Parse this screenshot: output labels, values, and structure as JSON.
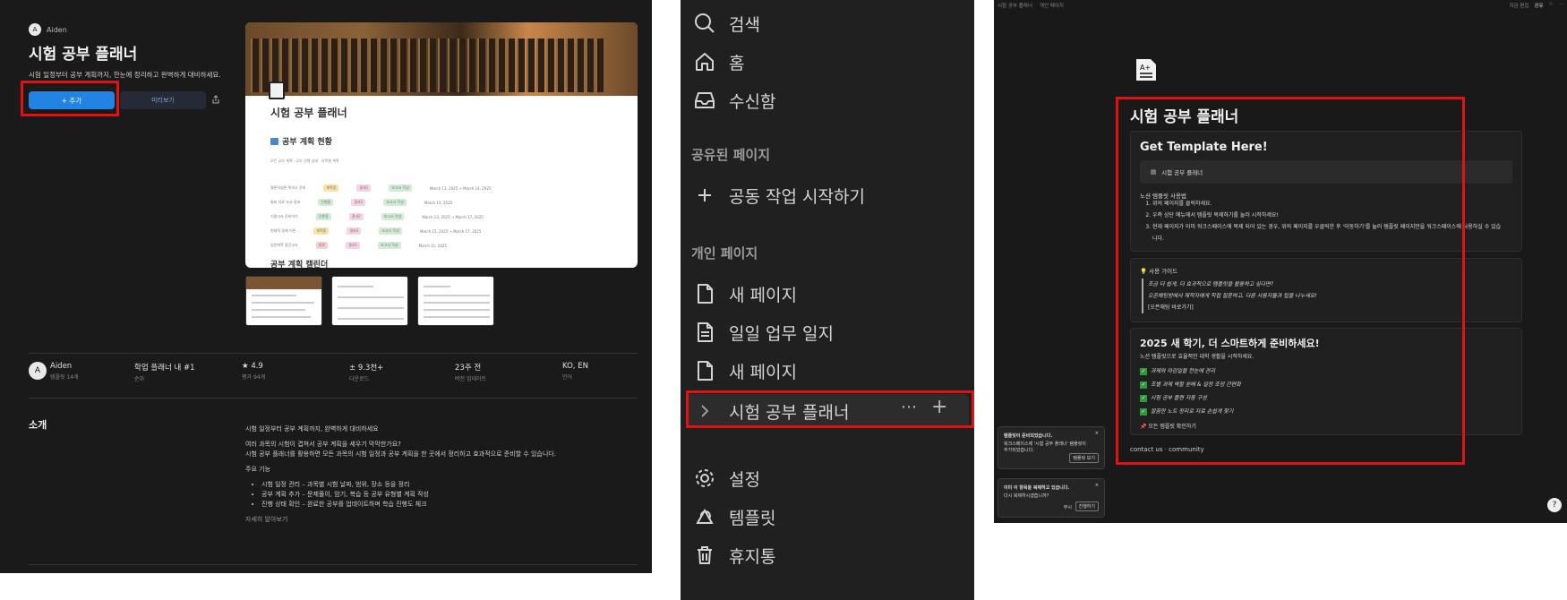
{
  "marketplace": {
    "author": "Aiden",
    "avatar_glyph": "A",
    "title": "시험 공부 플래너",
    "subtitle": "시험 일정부터 공부 계획까지, 한눈에 정리하고 완벽하게 대비하세요.",
    "add_button": "+ 추가",
    "preview_button": "미리보기",
    "preview": {
      "title": "시험 공부 플래너",
      "section": "공부 계획 현황",
      "tabs": "모든 공부 계획 · 공부 진행 상태 · 과목별 계획",
      "rows": [
        {
          "name": "결론작성론 족의고 준비",
          "status": "계획중",
          "tag2": "결과1",
          "tag3": "보고서 작성",
          "date": "March 13, 2025 → March 14, 2025"
        },
        {
          "name": "발표 자료 조사 정리",
          "status": "진행중",
          "tag2": "결과2",
          "tag3": "보고서 작성",
          "date": "March 13, 2025"
        },
        {
          "name": "기말고사 준비하기",
          "status": "진행중",
          "tag2": "결과2",
          "tag3": "보고서 작성",
          "date": "March 13, 2025 → March 17, 2025"
        },
        {
          "name": "현대적 경제 이론",
          "status": "계획중",
          "tag2": "결과3",
          "tag3": "보고서 작성",
          "date": "March 15, 2025 → March 17, 2025"
        },
        {
          "name": "일반화학 중간고사",
          "status": "완료",
          "tag2": "결과1",
          "tag3": "보고서 작성",
          "date": "March 11, 2025"
        }
      ],
      "calendar_heading": "공부 계획 캘린더"
    },
    "stats": [
      {
        "value": "Aiden",
        "label": "템플릿 14개"
      },
      {
        "value": "학업 플래너 내 #1",
        "label": "순위"
      },
      {
        "value": "★ 4.9",
        "label": "평가 94개"
      },
      {
        "value": "± 9.3천+",
        "label": "다운로드"
      },
      {
        "value": "23주 전",
        "label": "버전 업데이트"
      },
      {
        "value": "KO, EN",
        "label": "언어"
      }
    ],
    "intro_label": "소개",
    "intro_p1": "시험 일정부터 공부 계획까지, 완벽하게 대비하세요",
    "intro_p2": "여러 과목의 시험이 겹쳐서 공부 계획을 세우기 막막한가요?",
    "intro_p3": "시험 공부 플래너를 활용하면 모든 과목의 시험 일정과 공부 계획을 한 곳에서 정리하고 효과적으로 준비할 수 있습니다.",
    "features_label": "주요 기능",
    "features": [
      "시험 일정 관리 – 과목별 시험 날짜, 범위, 장소 등을 정리",
      "공부 계획 추가 – 문제풀이, 암기, 복습 등 공부 유형별 계획 작성",
      "진행 상태 확인 – 완료한 공부를 업데이트하며 학습 진행도 체크"
    ],
    "more": "자세히 알아보기"
  },
  "sidebar": {
    "search": "검색",
    "home": "홈",
    "inbox": "수신함",
    "shared_heading": "공유된 페이지",
    "start_collab": "공동 작업 시작하기",
    "private_heading": "개인 페이지",
    "pages": [
      "새 페이지",
      "일일 업무 일지",
      "새 페이지"
    ],
    "active_page": "시험 공부 플래너",
    "settings": "설정",
    "templates": "템플릿",
    "trash": "휴지통"
  },
  "notion_page": {
    "breadcrumb_1": "시험 공부 플래너",
    "breadcrumb_2": "개인 페이지",
    "edited": "지금 편집",
    "share": "공유",
    "title": "시험 공부 플래너",
    "get_template": "Get Template Here!",
    "template_link": "시험 공부 플래너",
    "usage_heading": "노션 템플릿 사용법",
    "steps": [
      "위의 페이지를 클릭하세요.",
      "우측 상단 메뉴에서 템플릿 복제하기를 눌러 시작하세요!",
      "현재 페이지가 이미 워크스페이스에 복제 되어 있는 경우, 위의 페이지를 우클릭한 후 '이동하기'를 눌러 템플릿 페이지만을 워크스페이스에 사용하실 수 있습니다."
    ],
    "guide_heading": "사용 가이드",
    "guide_q1": "조금 더 쉽게, 더 효과적으로 템플릿을 활용하고 싶다면?",
    "guide_q2": "오픈채팅방에서 제작자에게 직접 질문하고, 다른 사용자들과 팁을 나누세요!",
    "guide_link": "[오픈채팅 바로가기]",
    "promo_heading": "2025 새 학기, 더 스마트하게 준비하세요!",
    "promo_desc": "노션 템플릿으로 효율적인 대학 생활을 시작하세요.",
    "promo_items": [
      "과제와 마감일을 한눈에 관리",
      "조별 과제 역할 분배 & 일정 조정 간편화",
      "시험 공부 플랜 자동 구성",
      "깔끔한 노트 정리로 자료 손쉽게 찾기"
    ],
    "all_templates": "📌 모든 템플릿 확인하기",
    "footer": "contact us · community",
    "toast1_title": "템플릿이 준비되었습니다.",
    "toast1_body": "워크스페이스에 '시험 공부 플래너' 템플릿이 추가되었습니다.",
    "toast1_btn": "템플릿 보기",
    "toast2_title": "이미 이 항목을 복제하고 있습니다.",
    "toast2_body": "다시 복제하시겠습니까?",
    "toast2_cancel": "무시",
    "toast2_btn": "진행하기",
    "help": "?"
  },
  "colors": {
    "accent": "#2383e2",
    "highlight": "#e31212"
  }
}
